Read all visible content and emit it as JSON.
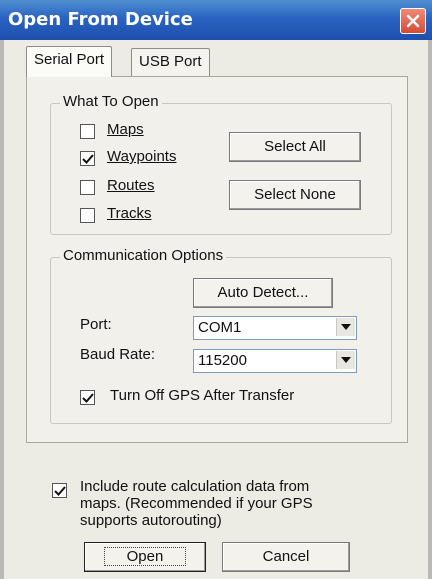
{
  "window": {
    "title": "Open From Device"
  },
  "tabs": [
    {
      "label": "Serial Port",
      "active": true
    },
    {
      "label": "USB Port",
      "active": false
    }
  ],
  "what_to_open": {
    "legend": "What To Open",
    "items": [
      {
        "label": "Maps",
        "checked": false
      },
      {
        "label": "Waypoints",
        "checked": true
      },
      {
        "label": "Routes",
        "checked": false
      },
      {
        "label": "Tracks",
        "checked": false
      }
    ],
    "select_all_label": "Select All",
    "select_none_label": "Select None"
  },
  "communication": {
    "legend": "Communication Options",
    "auto_detect_label": "Auto Detect...",
    "port_label": "Port:",
    "port_value": "COM1",
    "baud_label": "Baud Rate:",
    "baud_value": "115200",
    "turn_off_label": "Turn Off GPS After Transfer",
    "turn_off_checked": true
  },
  "route_calc": {
    "checked": true,
    "line1": "Include route calculation data from",
    "line2": "maps.  (Recommended if your GPS",
    "line3": "supports autorouting)"
  },
  "buttons": {
    "open_label": "Open",
    "cancel_label": "Cancel"
  },
  "icons": {
    "close": "close-icon",
    "check": "checkmark-icon",
    "dropdown": "chevron-down-icon"
  }
}
